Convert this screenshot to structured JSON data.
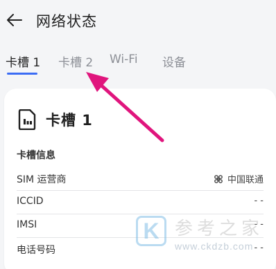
{
  "header": {
    "back_icon": "back-arrow-icon",
    "title": "网络状态"
  },
  "tabs": [
    {
      "label": "卡槽 1",
      "active": true
    },
    {
      "label": "卡槽 2",
      "active": false
    },
    {
      "label": "Wi-Fi",
      "active": false
    },
    {
      "label": "设备",
      "active": false
    }
  ],
  "card": {
    "icon": "sim-card-icon",
    "title": "卡槽 1",
    "section_label": "卡槽信息",
    "rows": [
      {
        "key": "SIM 运营商",
        "value": "中国联通",
        "icon": "china-unicom-logo-icon"
      },
      {
        "key": "ICCID",
        "value": "- -"
      },
      {
        "key": "IMSI",
        "value": "- -"
      },
      {
        "key": "电话号码",
        "value": "- -"
      }
    ]
  },
  "annotation": {
    "color": "#e0157d"
  },
  "watermark": {
    "box_letter": "K",
    "text": "参考之家",
    "url": "www.ckdzb.com"
  },
  "colors": {
    "accent": "#3a6cf4",
    "background": "#f4f5f7",
    "card": "#ffffff",
    "inactive_tab": "#8c8f96"
  }
}
